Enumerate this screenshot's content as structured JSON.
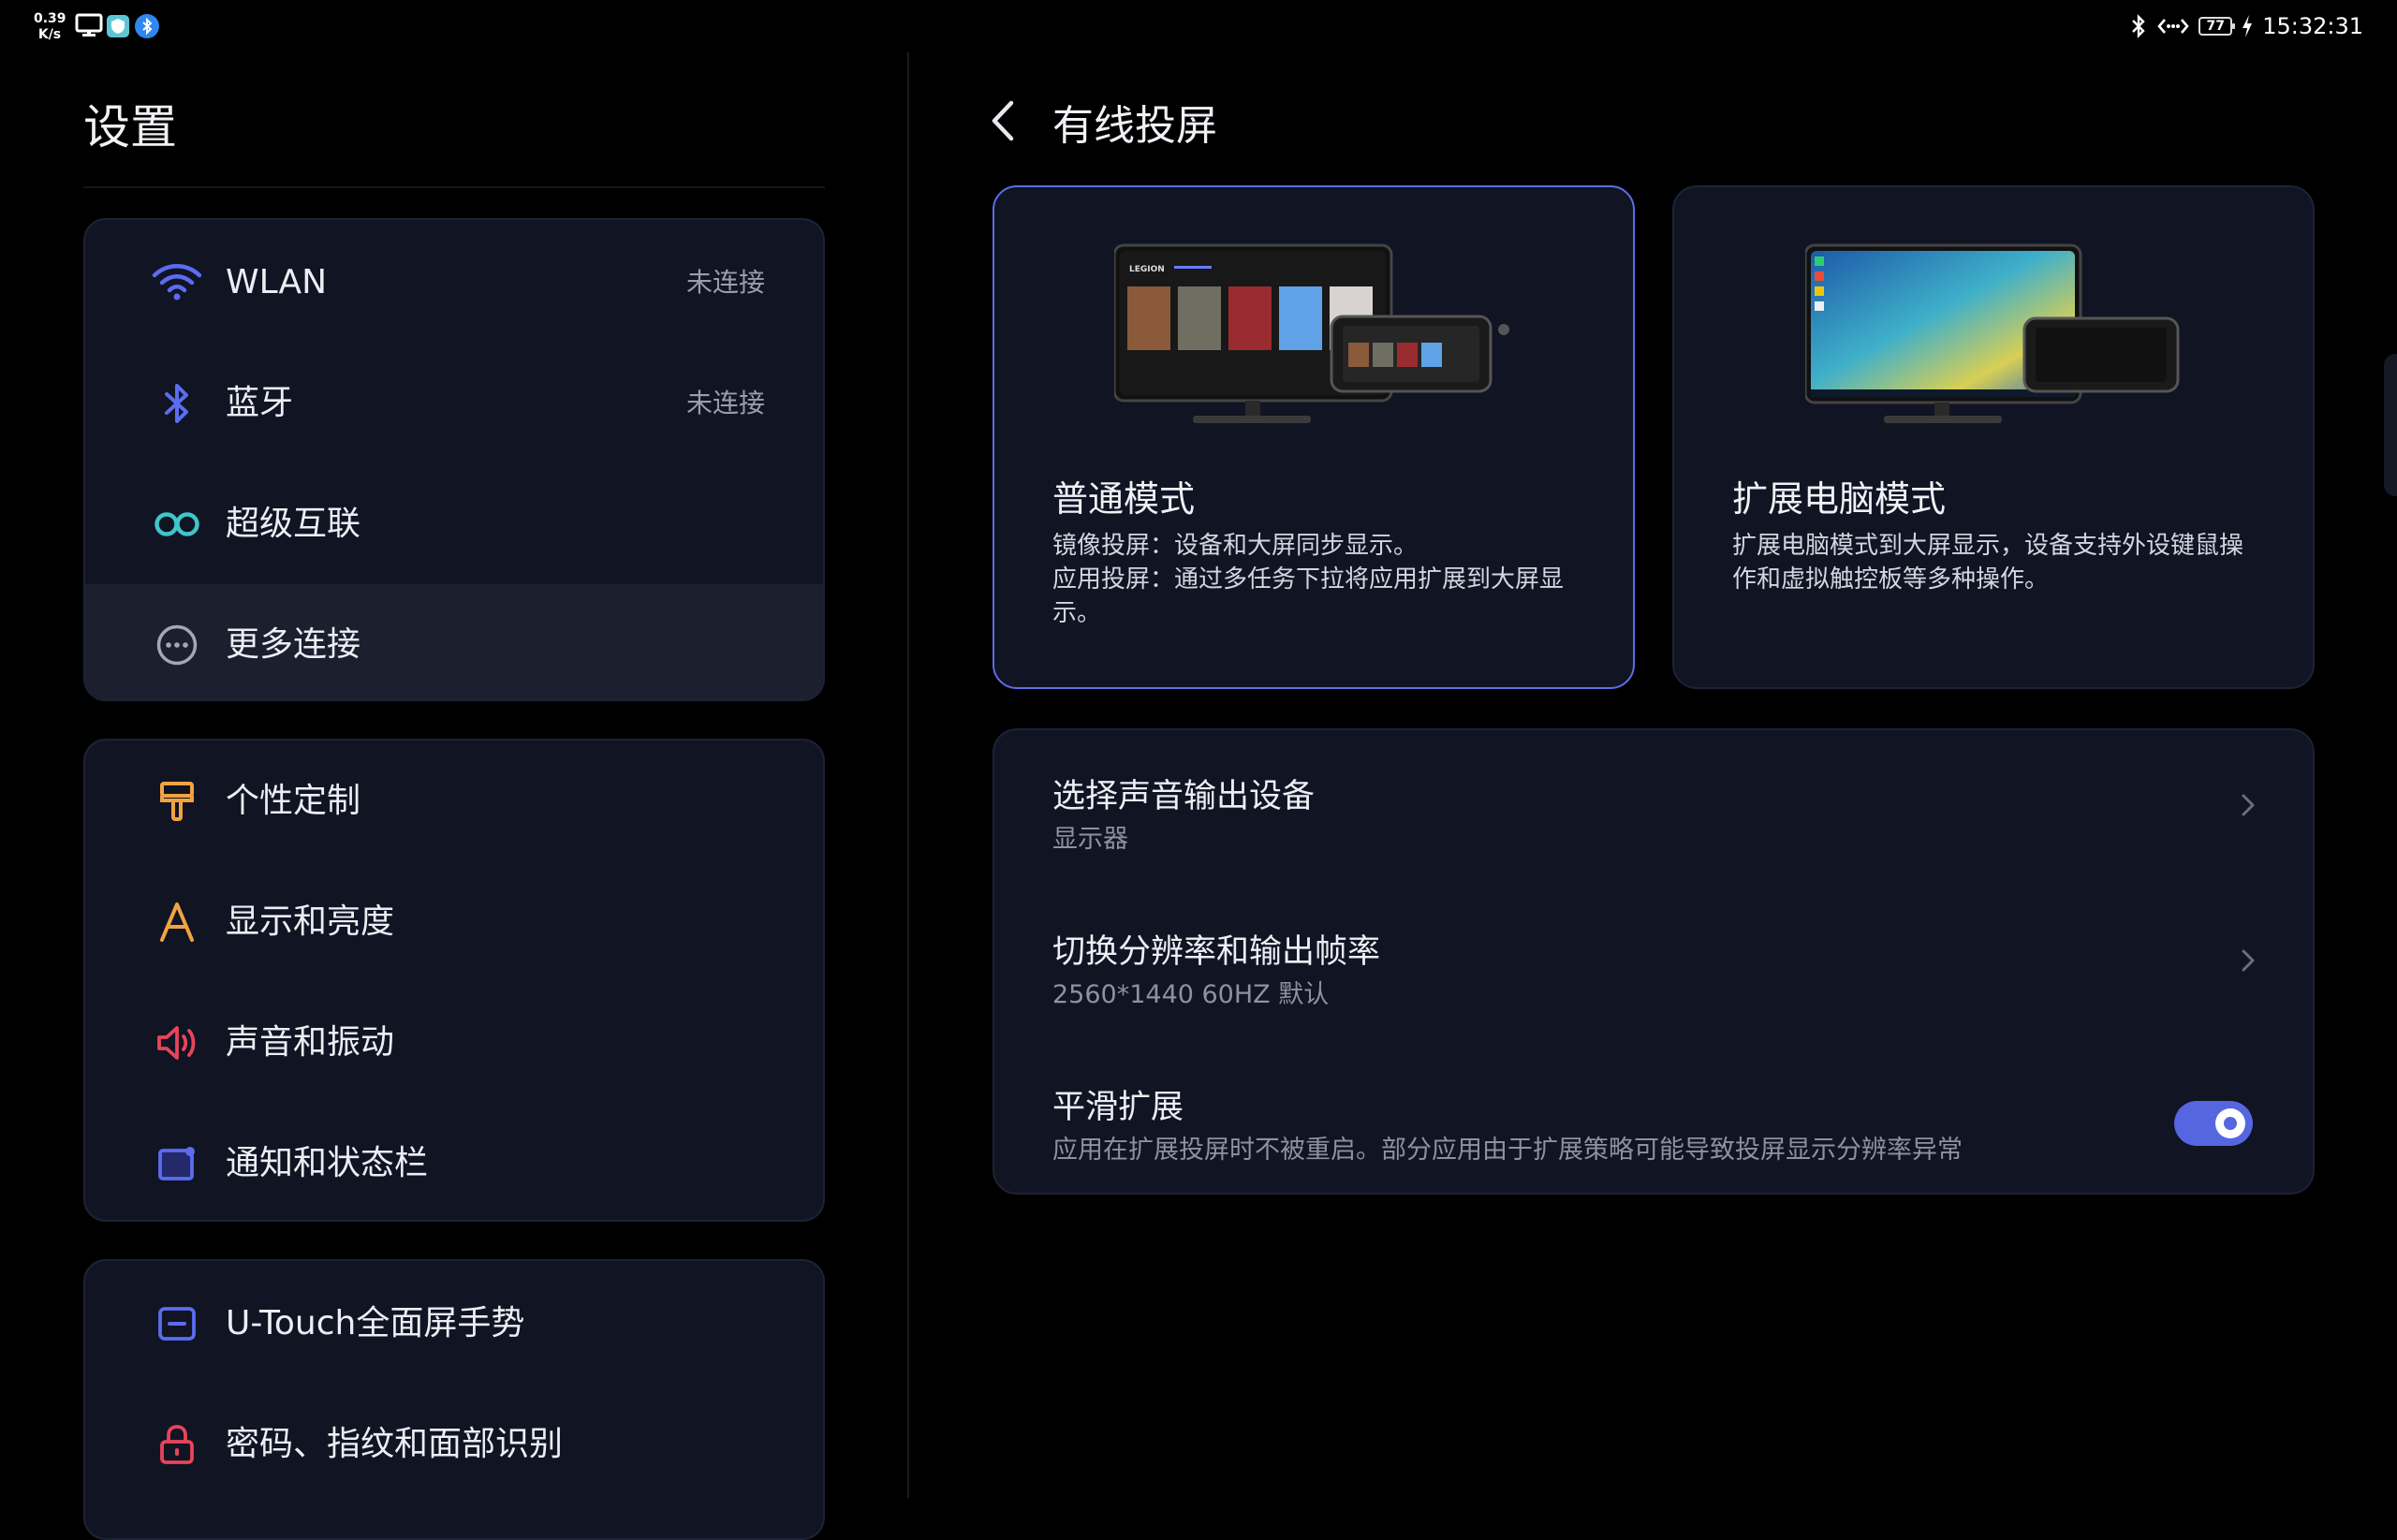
{
  "status_bar": {
    "net_speed_value": "0.39",
    "net_speed_unit": "K/s",
    "time": "15:32:31",
    "battery": "77",
    "left_icons": [
      "monitor-icon",
      "shield-app-icon",
      "bluetooth-badge-icon"
    ],
    "right_icons": [
      "bluetooth-icon",
      "data-transfer-icon",
      "battery-icon",
      "charging-icon"
    ]
  },
  "sidebar": {
    "title": "设置",
    "groups": [
      {
        "items": [
          {
            "label": "WLAN",
            "value": "未连接",
            "icon": "wifi-icon",
            "icon_color": "#5b6cf0"
          },
          {
            "label": "蓝牙",
            "value": "未连接",
            "icon": "bluetooth-icon",
            "icon_color": "#5b6cf0"
          },
          {
            "label": "超级互联",
            "icon": "infinity-icon",
            "icon_color": "#3ec6c8"
          },
          {
            "label": "更多连接",
            "icon": "more-dots-icon",
            "icon_color": "#a5a8b4",
            "selected": true
          }
        ]
      },
      {
        "items": [
          {
            "label": "个性定制",
            "icon": "paint-roller-icon",
            "icon_color": "#f2a341"
          },
          {
            "label": "显示和亮度",
            "icon": "letter-a-icon",
            "icon_color": "#f2a341"
          },
          {
            "label": "声音和振动",
            "icon": "speaker-icon",
            "icon_color": "#e8445a"
          },
          {
            "label": "通知和状态栏",
            "icon": "notification-icon",
            "icon_color": "#5b6cf0"
          }
        ]
      },
      {
        "items": [
          {
            "label": "U-Touch全面屏手势",
            "icon": "gesture-icon",
            "icon_color": "#5b6cf0"
          },
          {
            "label": "密码、指纹和面部识别",
            "icon": "lock-icon",
            "icon_color": "#e8445a"
          }
        ]
      }
    ]
  },
  "main": {
    "title": "有线投屏",
    "modes": [
      {
        "name": "普通模式",
        "desc_lines": [
          "镜像投屏：设备和大屏同步显示。",
          "应用投屏：通过多任务下拉将应用扩展到大屏显",
          "示。"
        ],
        "selected": true
      },
      {
        "name": "扩展电脑模式",
        "desc_lines": [
          "扩展电脑模式到大屏显示，设备支持外设键鼠操",
          "作和虚拟触控板等多种操作。"
        ],
        "selected": false
      }
    ],
    "options": [
      {
        "title": "选择声音输出设备",
        "subtitle": "显示器",
        "control": "chevron"
      },
      {
        "title": "切换分辨率和输出帧率",
        "subtitle": "2560*1440 60HZ 默认",
        "control": "chevron"
      },
      {
        "title": "平滑扩展",
        "subtitle": "应用在扩展投屏时不被重启。部分应用由于扩展策略可能导致投屏显示分辨率异常",
        "control": "toggle",
        "toggle_on": true
      }
    ],
    "accent_color": "#5566e0",
    "illustration_brand": "LEGION"
  }
}
